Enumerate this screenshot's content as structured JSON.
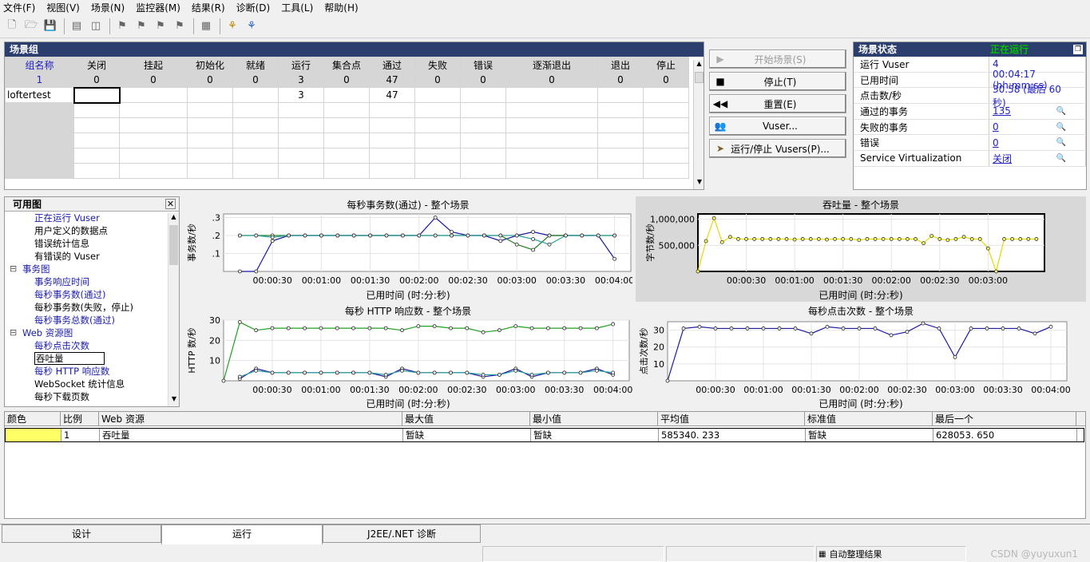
{
  "menu": [
    "文件(F)",
    "视图(V)",
    "场景(N)",
    "监控器(M)",
    "结果(R)",
    "诊断(D)",
    "工具(L)",
    "帮助(H)"
  ],
  "scenario_group": {
    "title": "场景组",
    "headers": [
      "组名称",
      "关闭",
      "挂起",
      "初始化",
      "就绪",
      "运行",
      "集合点",
      "通过",
      "失败",
      "错误",
      "逐渐退出",
      "退出",
      "停止"
    ],
    "totals": [
      "1",
      "0",
      "0",
      "0",
      "0",
      "3",
      "0",
      "47",
      "0",
      "0",
      "0",
      "0",
      "0"
    ],
    "row": [
      "loftertest",
      "",
      "",
      "",
      "",
      "3",
      "",
      "47",
      "",
      "",
      "",
      "",
      ""
    ]
  },
  "buttons": {
    "start": "开始场景(S)",
    "stop": "停止(T)",
    "reset": "重置(E)",
    "vusers": "Vuser...",
    "run_stop": "运行/停止 Vusers(P)..."
  },
  "status": {
    "title": "场景状态",
    "state": "正在运行",
    "rows": [
      {
        "k": "运行 Vuser",
        "v": "4"
      },
      {
        "k": "已用时间",
        "v": "00:04:17 (hh:mm:ss)"
      },
      {
        "k": "点击数/秒",
        "v": "30.58 (最后 60 秒)"
      },
      {
        "k": "通过的事务",
        "v": "135"
      },
      {
        "k": "失败的事务",
        "v": "0"
      },
      {
        "k": "错误",
        "v": "0"
      },
      {
        "k": "Service Virtualization",
        "v": "关闭"
      }
    ]
  },
  "tree": {
    "title": "可用图",
    "items": [
      {
        "t": "正在运行 Vuser",
        "lvl": 2,
        "blue": true
      },
      {
        "t": "用户定义的数据点",
        "lvl": 2,
        "blue": false
      },
      {
        "t": "错误统计信息",
        "lvl": 2,
        "blue": false
      },
      {
        "t": "有错误的 Vuser",
        "lvl": 2,
        "blue": false
      },
      {
        "t": "事务图",
        "lvl": 1,
        "blue": true
      },
      {
        "t": "事务响应时间",
        "lvl": 2,
        "blue": true
      },
      {
        "t": "每秒事务数(通过)",
        "lvl": 2,
        "blue": true
      },
      {
        "t": "每秒事务数(失败，停止)",
        "lvl": 2,
        "blue": false
      },
      {
        "t": "每秒事务总数(通过)",
        "lvl": 2,
        "blue": true
      },
      {
        "t": "Web 资源图",
        "lvl": 1,
        "blue": true
      },
      {
        "t": "每秒点击次数",
        "lvl": 2,
        "blue": true
      },
      {
        "t": "吞吐量",
        "lvl": 2,
        "blue": false,
        "sel": true
      },
      {
        "t": "每秒 HTTP 响应数",
        "lvl": 2,
        "blue": true
      },
      {
        "t": "WebSocket 统计信息",
        "lvl": 2,
        "blue": false
      },
      {
        "t": "每秒下载页数",
        "lvl": 2,
        "blue": false
      }
    ]
  },
  "colors": {
    "title_bar": "#2c3e6e",
    "running": "#00c000",
    "link": "#2020c0",
    "legend_swatch": "#ffff66"
  },
  "legend": {
    "headers": [
      "颜色",
      "比例",
      "Web 资源",
      "最大值",
      "最小值",
      "平均值",
      "标准值",
      "最后一个"
    ],
    "row": [
      "",
      "1",
      "吞吐量",
      "暂缺",
      "暂缺",
      "585340. 233",
      "暂缺",
      "628053. 650"
    ]
  },
  "tabs": [
    "设计",
    "运行",
    "J2EE/.NET 诊断"
  ],
  "statusbar": {
    "auto_collate": "自动整理结果"
  },
  "watermark": "CSDN @yuyuxun1",
  "chart_data": [
    {
      "type": "line",
      "title": "每秒事务数(通过) - 整个场景",
      "xlabel": "已用时间 (时:分:秒)",
      "ylabel": "事务数/秒",
      "x_ticks": [
        "00:00:30",
        "00:01:00",
        "00:01:30",
        "00:02:00",
        "00:02:30",
        "00:03:00",
        "00:03:30",
        "00:04:00"
      ],
      "y_ticks": [
        ".1",
        ".2",
        ".3"
      ],
      "xlim": [
        0,
        250
      ],
      "ylim": [
        0,
        0.32
      ],
      "series": [
        {
          "color": "#1a1aa0",
          "x": [
            10,
            20,
            30,
            40,
            50,
            60,
            70,
            80,
            90,
            100,
            110,
            120,
            130,
            140,
            150,
            160,
            170,
            180,
            190,
            200,
            210,
            220,
            230,
            240
          ],
          "y": [
            0,
            0,
            0.17,
            0.2,
            0.2,
            0.2,
            0.2,
            0.2,
            0.2,
            0.2,
            0.2,
            0.2,
            0.3,
            0.22,
            0.2,
            0.2,
            0.17,
            0.2,
            0.22,
            0.2,
            0.2,
            0.2,
            0.2,
            0.07
          ]
        },
        {
          "color": "#208020",
          "x": [
            10,
            20,
            30,
            40,
            50,
            60,
            70,
            80,
            90,
            100,
            110,
            120,
            130,
            140,
            150,
            160,
            170,
            180,
            190,
            200,
            210,
            220,
            230,
            240
          ],
          "y": [
            0.2,
            0.2,
            0.2,
            0.2,
            0.2,
            0.2,
            0.2,
            0.2,
            0.2,
            0.2,
            0.2,
            0.2,
            0.2,
            0.2,
            0.2,
            0.2,
            0.2,
            0.15,
            0.12,
            0.2,
            0.2,
            0.2,
            0.2,
            0.2
          ]
        },
        {
          "color": "#30a0a0",
          "x": [
            10,
            20,
            30,
            40,
            50,
            60,
            70,
            80,
            90,
            100,
            110,
            120,
            130,
            140,
            150,
            160,
            170,
            180,
            190,
            200,
            210,
            220,
            230,
            240
          ],
          "y": [
            0.2,
            0.2,
            0.19,
            0.2,
            0.2,
            0.2,
            0.2,
            0.2,
            0.2,
            0.2,
            0.2,
            0.2,
            0.2,
            0.2,
            0.2,
            0.2,
            0.2,
            0.2,
            0.18,
            0.15,
            0.2,
            0.2,
            0.2,
            0.2
          ]
        }
      ]
    },
    {
      "type": "line",
      "title": "吞吐量 - 整个场景",
      "xlabel": "已用时间 (时:分:秒)",
      "ylabel": "字节数/秒",
      "x_ticks": [
        "00:00:30",
        "00:01:00",
        "00:01:30",
        "00:02:00",
        "00:02:30",
        "00:03:00"
      ],
      "y_ticks": [
        "500,000",
        "1,000,000"
      ],
      "xlim": [
        0,
        215
      ],
      "ylim": [
        0,
        1100000
      ],
      "series": [
        {
          "color": "#e8d800",
          "x": [
            0,
            5,
            10,
            15,
            20,
            25,
            30,
            35,
            40,
            45,
            50,
            55,
            60,
            65,
            70,
            75,
            80,
            85,
            90,
            95,
            100,
            105,
            110,
            115,
            120,
            125,
            130,
            135,
            140,
            145,
            150,
            155,
            160,
            165,
            170,
            175,
            180,
            185,
            190,
            195,
            200,
            205,
            210
          ],
          "y": [
            0,
            580000,
            1020000,
            560000,
            660000,
            620000,
            620000,
            620000,
            620000,
            620000,
            620000,
            620000,
            610000,
            620000,
            620000,
            620000,
            610000,
            620000,
            620000,
            620000,
            600000,
            620000,
            620000,
            620000,
            620000,
            620000,
            620000,
            620000,
            540000,
            680000,
            620000,
            600000,
            620000,
            660000,
            620000,
            620000,
            440000,
            0,
            620000,
            620000,
            620000,
            620000,
            620000
          ]
        }
      ]
    },
    {
      "type": "line",
      "title": "每秒 HTTP 响应数 - 整个场景",
      "xlabel": "已用时间 (时:分:秒)",
      "ylabel": "HTTP 数/秒",
      "x_ticks": [
        "00:00:30",
        "00:01:00",
        "00:01:30",
        "00:02:00",
        "00:02:30",
        "00:03:00",
        "00:03:30",
        "00:04:00"
      ],
      "y_ticks": [
        "10",
        "20",
        "30"
      ],
      "xlim": [
        0,
        250
      ],
      "ylim": [
        0,
        30
      ],
      "series": [
        {
          "color": "#20a020",
          "x": [
            0,
            10,
            20,
            30,
            40,
            50,
            60,
            70,
            80,
            90,
            100,
            110,
            120,
            130,
            140,
            150,
            160,
            170,
            180,
            190,
            200,
            210,
            220,
            230,
            240
          ],
          "y": [
            0,
            29,
            25,
            26,
            26,
            26,
            26,
            26,
            26,
            26,
            26,
            25,
            27,
            27,
            26,
            26,
            24,
            25,
            27,
            26,
            26,
            26,
            26,
            26,
            28
          ]
        },
        {
          "color": "#1a1aa0",
          "x": [
            10,
            20,
            30,
            40,
            50,
            60,
            70,
            80,
            90,
            100,
            110,
            120,
            130,
            140,
            150,
            160,
            170,
            180,
            190,
            200,
            210,
            220,
            230,
            240
          ],
          "y": [
            1,
            6,
            4,
            4,
            4,
            4,
            4,
            4,
            4,
            2,
            6,
            4,
            4,
            4,
            4,
            2,
            3,
            6,
            2,
            4,
            4,
            4,
            6,
            3
          ]
        },
        {
          "color": "#30a0a0",
          "x": [
            10,
            20,
            30,
            40,
            50,
            60,
            70,
            80,
            90,
            100,
            110,
            120,
            130,
            140,
            150,
            160,
            170,
            180,
            190,
            200,
            210,
            220,
            230,
            240
          ],
          "y": [
            2,
            5,
            4,
            4,
            4,
            4,
            4,
            4,
            4,
            3,
            5,
            4,
            4,
            4,
            4,
            3,
            3,
            5,
            3,
            4,
            4,
            4,
            5,
            4
          ]
        }
      ]
    },
    {
      "type": "line",
      "title": "每秒点击次数 - 整个场景",
      "xlabel": "已用时间 (时:分:秒)",
      "ylabel": "点击次数/秒",
      "x_ticks": [
        "00:00:30",
        "00:01:00",
        "00:01:30",
        "00:02:00",
        "00:02:30",
        "00:03:00",
        "00:03:30",
        "00:04:00"
      ],
      "y_ticks": [
        "10",
        "20",
        "30"
      ],
      "xlim": [
        0,
        250
      ],
      "ylim": [
        0,
        35
      ],
      "series": [
        {
          "color": "#1a1aa0",
          "x": [
            0,
            10,
            20,
            30,
            40,
            50,
            60,
            70,
            80,
            90,
            100,
            110,
            120,
            130,
            140,
            150,
            160,
            170,
            180,
            190,
            200,
            210,
            220,
            230,
            240
          ],
          "y": [
            0,
            31,
            32,
            31,
            31,
            31,
            31,
            31,
            31,
            28,
            32,
            31,
            31,
            31,
            27,
            29,
            34,
            31,
            14,
            31,
            31,
            31,
            31,
            28,
            32
          ]
        }
      ]
    }
  ]
}
